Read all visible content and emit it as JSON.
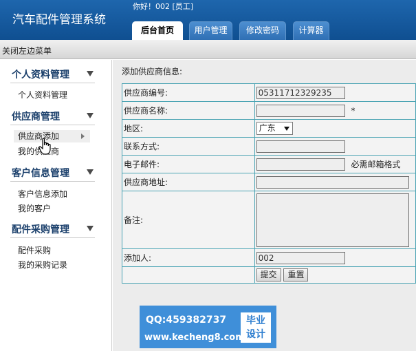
{
  "header": {
    "app_title": "汽车配件管理系统",
    "greeting": "你好！002 [员工]",
    "tabs": [
      {
        "label": "后台首页",
        "active": true
      },
      {
        "label": "用户管理",
        "active": false
      },
      {
        "label": "修改密码",
        "active": false
      },
      {
        "label": "计算器",
        "active": false
      }
    ]
  },
  "subbar": {
    "toggle_menu": "关闭左边菜单"
  },
  "sidebar": {
    "groups": [
      {
        "title": "个人资料管理",
        "items": [
          "个人资料管理"
        ]
      },
      {
        "title": "供应商管理",
        "items": [
          "供应商添加",
          "我的供应商"
        ]
      },
      {
        "title": "客户信息管理",
        "items": [
          "客户信息添加",
          "我的客户"
        ]
      },
      {
        "title": "配件采购管理",
        "items": [
          "配件采购",
          "我的采购记录"
        ]
      }
    ]
  },
  "form": {
    "heading": "添加供应商信息:",
    "supplier_id_label": "供应商编号:",
    "supplier_id_value": "05311712329235",
    "supplier_name_label": "供应商名称:",
    "supplier_name_value": "",
    "required_mark": "*",
    "region_label": "地区:",
    "region_value": "广东",
    "contact_label": "联系方式:",
    "contact_value": "",
    "email_label": "电子邮件:",
    "email_value": "",
    "email_hint": "必需邮箱格式",
    "address_label": "供应商地址:",
    "address_value": "",
    "remark_label": "备注:",
    "remark_value": "",
    "added_by_label": "添加人:",
    "added_by_value": "002",
    "submit_label": "提交",
    "reset_label": "重置"
  },
  "watermark": {
    "qq": "QQ:459382737",
    "site": "www.kecheng8.com",
    "badge_line1": "毕业",
    "badge_line2": "设计"
  },
  "colors": {
    "header_blue": "#1a5c9f",
    "table_border": "#49a3b3",
    "watermark_blue": "#3f8fd9"
  }
}
